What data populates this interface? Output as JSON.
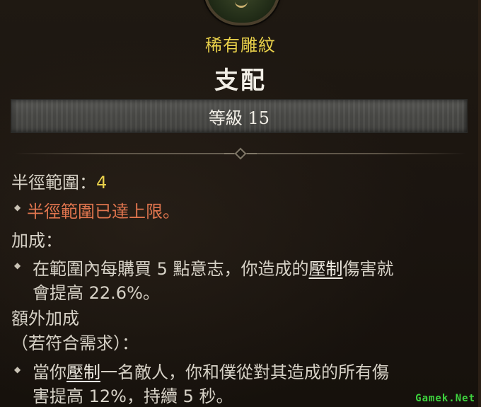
{
  "tooltip": {
    "rarity": "稀有雕紋",
    "name": "支配",
    "level_label": "等級 15",
    "radius_label": "半徑範圍：",
    "radius_value": "4",
    "radius_max_note": "半徑範圍已達上限。",
    "bonus_header": "加成：",
    "bonus_line1_a": "在範圍內每購買 5 點意志，你造成的",
    "bonus_line1_keyword": "壓制",
    "bonus_line1_b": "傷害就",
    "bonus_line2": "會提高 22.6%。",
    "extra_header": "額外加成",
    "extra_requirement": "（若符合需求）：",
    "extra_line1_a": "當你",
    "extra_line1_keyword": "壓制",
    "extra_line1_b": "一名敵人，你和僕從對其造成的所有傷",
    "extra_line2": "害提高 12%，持續 5 秒。"
  },
  "watermark": "Gamek.Net",
  "colors": {
    "rarity": "#e8d04a",
    "title": "#f2efe7",
    "body": "#d6d1c6",
    "capped": "#e0754e",
    "level_bar": "#4b4b48"
  },
  "icons": {
    "emblem": "glyph-emblem-icon",
    "bullet": "diamond-bullet-icon",
    "divider": "ornament-divider-icon"
  }
}
